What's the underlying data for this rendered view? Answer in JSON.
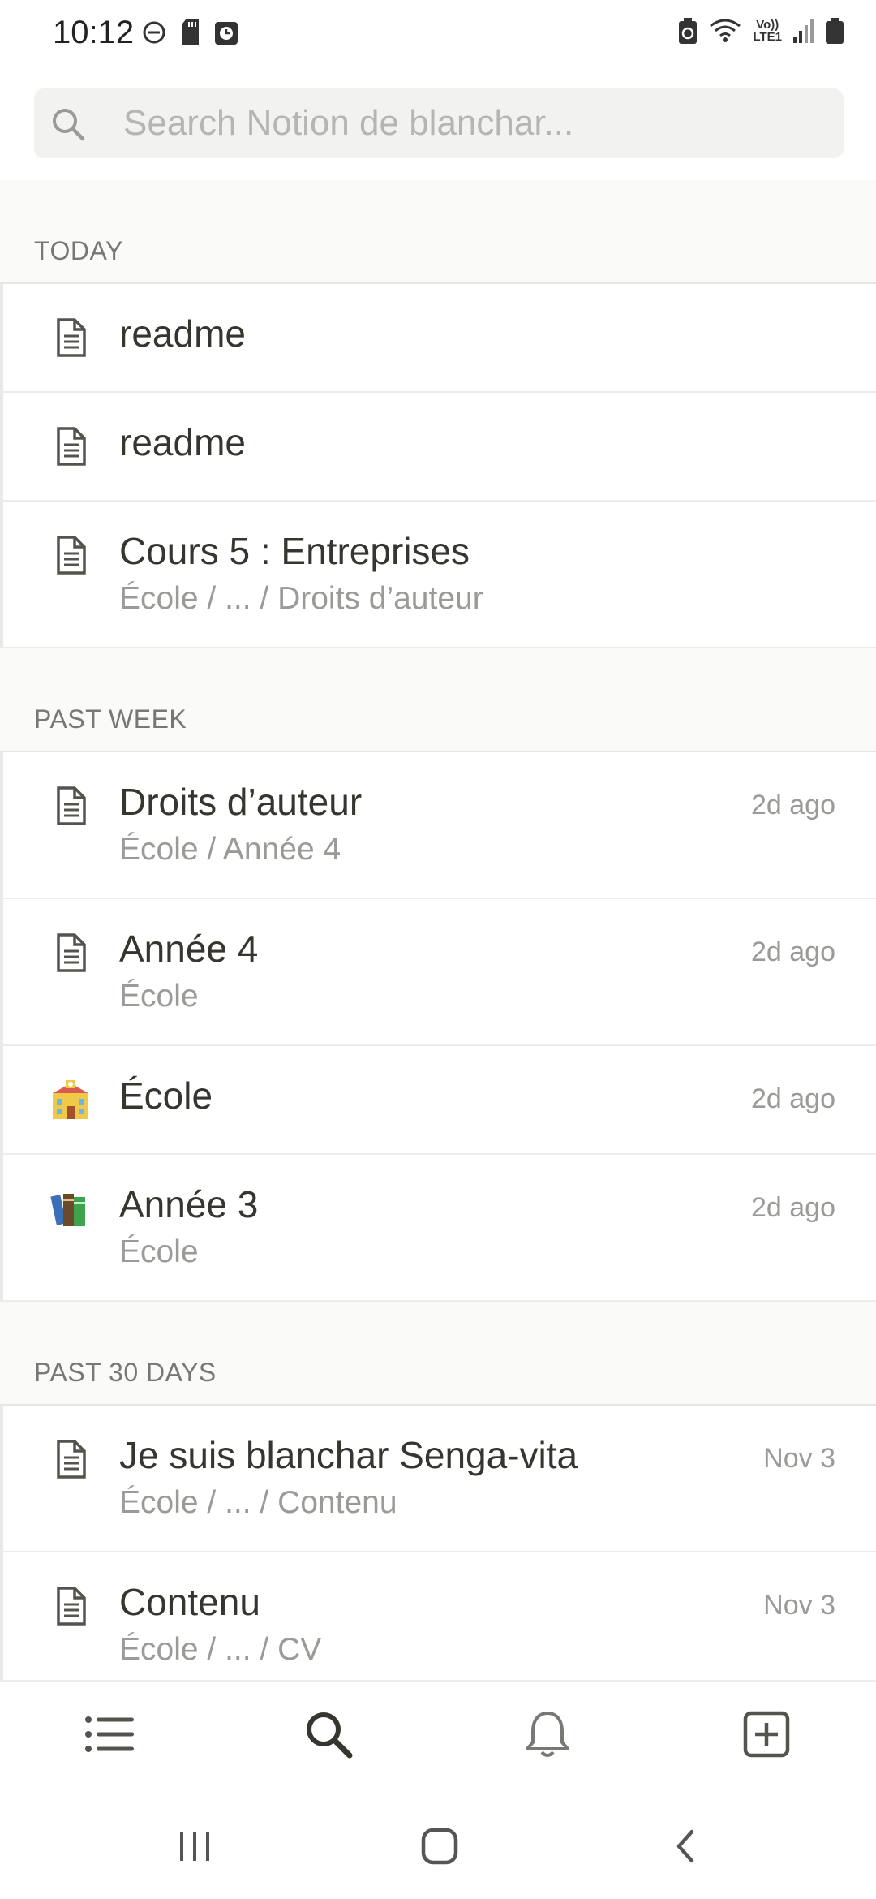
{
  "status_bar": {
    "time": "10:12",
    "left_icons": [
      "do-not-disturb-icon",
      "sd-card-icon",
      "alarm-icon"
    ],
    "right_icons": [
      "battery-saver-icon",
      "wifi-icon",
      "volte-lte-icon",
      "signal-icon",
      "battery-icon"
    ],
    "network_label_top": "Vo))",
    "network_label_bottom": "LTE1"
  },
  "search": {
    "placeholder": "Search Notion de blanchar..."
  },
  "sections": [
    {
      "header": "TODAY",
      "rows": [
        {
          "icon": "page-icon",
          "title": "readme",
          "path": "",
          "time": ""
        },
        {
          "icon": "page-icon",
          "title": "readme",
          "path": "",
          "time": ""
        },
        {
          "icon": "page-icon",
          "title": "Cours 5 : Entreprises",
          "path": "École / ... / Droits d’auteur",
          "time": ""
        }
      ]
    },
    {
      "header": "PAST WEEK",
      "rows": [
        {
          "icon": "page-icon",
          "title": "Droits d’auteur",
          "path": "École / Année 4",
          "time": "2d ago"
        },
        {
          "icon": "page-icon",
          "title": "Année 4",
          "path": "École",
          "time": "2d ago"
        },
        {
          "icon": "school-emoji-icon",
          "title": "École",
          "path": "",
          "time": "2d ago"
        },
        {
          "icon": "books-emoji-icon",
          "title": "Année 3",
          "path": "École",
          "time": "2d ago"
        }
      ]
    },
    {
      "header": "PAST 30 DAYS",
      "rows": [
        {
          "icon": "page-icon",
          "title": "Je suis blanchar Senga-vita",
          "path": "École / ... / Contenu",
          "time": "Nov 3"
        },
        {
          "icon": "page-icon",
          "title": "Contenu",
          "path": "École / ... / CV",
          "time": "Nov 3"
        }
      ]
    }
  ],
  "bottom_nav": [
    "list-icon",
    "search-icon",
    "bell-icon",
    "new-page-icon"
  ],
  "system_nav": [
    "recents-icon",
    "home-icon",
    "back-icon"
  ]
}
